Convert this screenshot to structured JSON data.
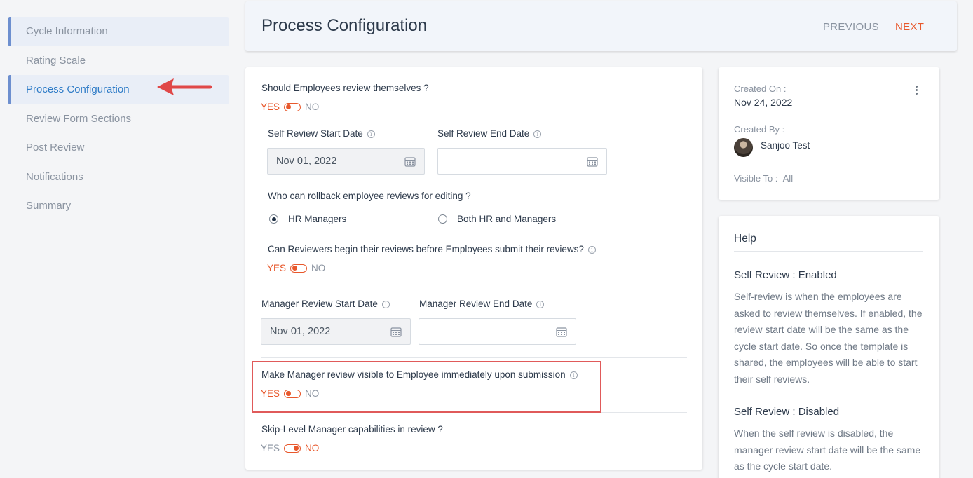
{
  "sidebar": {
    "items": [
      {
        "label": "Cycle Information"
      },
      {
        "label": "Rating Scale"
      },
      {
        "label": "Process Configuration"
      },
      {
        "label": "Review Form Sections"
      },
      {
        "label": "Post Review"
      },
      {
        "label": "Notifications"
      },
      {
        "label": "Summary"
      }
    ],
    "active_index": 2
  },
  "header": {
    "title": "Process Configuration",
    "previous": "PREVIOUS",
    "next": "NEXT"
  },
  "form": {
    "self_review": {
      "question": "Should Employees review themselves ?",
      "yes": "YES",
      "no": "NO",
      "value": "YES"
    },
    "self_review_start": {
      "label": "Self Review Start Date",
      "value": "Nov 01, 2022"
    },
    "self_review_end": {
      "label": "Self Review End Date",
      "value": ""
    },
    "rollback": {
      "question": "Who can rollback employee reviews for editing ?",
      "options": [
        "HR Managers",
        "Both HR and Managers"
      ],
      "selected": "HR Managers"
    },
    "reviewers_begin": {
      "question": "Can Reviewers begin their reviews before Employees submit their reviews?",
      "yes": "YES",
      "no": "NO",
      "value": "YES"
    },
    "manager_review_start": {
      "label": "Manager Review Start Date",
      "value": "Nov 01, 2022"
    },
    "manager_review_end": {
      "label": "Manager Review End Date",
      "value": ""
    },
    "manager_visible": {
      "question": "Make Manager review visible to Employee immediately upon submission",
      "yes": "YES",
      "no": "NO",
      "value": "YES"
    },
    "skip_level": {
      "question": "Skip-Level Manager capabilities in review ?",
      "yes": "YES",
      "no": "NO",
      "value": "NO"
    }
  },
  "meta": {
    "created_on_label": "Created On :",
    "created_on": "Nov 24, 2022",
    "created_by_label": "Created By :",
    "created_by": "Sanjoo Test",
    "visible_to_label": "Visible To :",
    "visible_to": "All"
  },
  "help": {
    "title": "Help",
    "sections": [
      {
        "heading": "Self Review : Enabled",
        "text": "Self-review is when the employees are asked to review themselves. If enabled, the review start date will be the same as the cycle start date. So once the template is shared, the employees will be able to start their self reviews."
      },
      {
        "heading": "Self Review : Disabled",
        "text": "When the self review is disabled, the manager review start date will be the same as the cycle start date."
      }
    ]
  },
  "colors": {
    "accent": "#e8582c",
    "active_link": "#2f7cc7",
    "annotation": "#e05a5a"
  }
}
